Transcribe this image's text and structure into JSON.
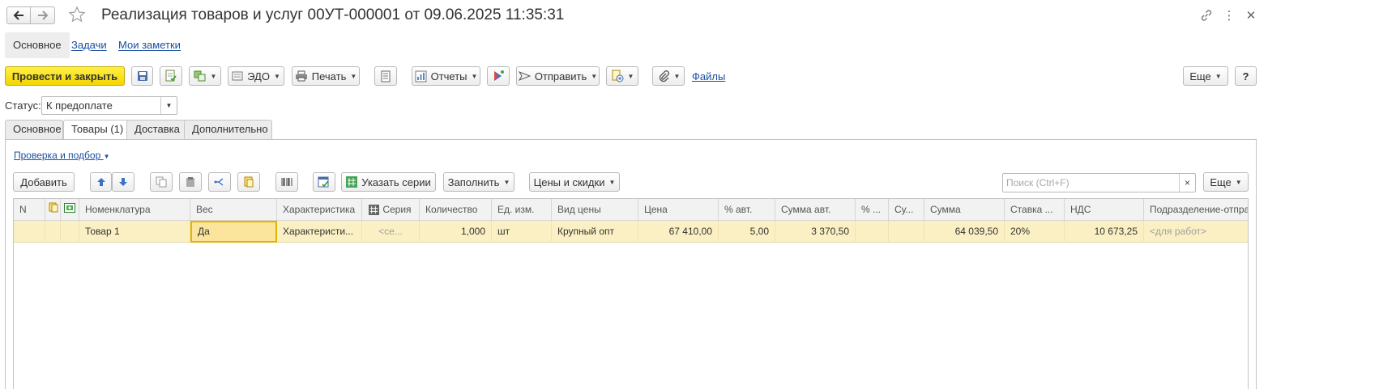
{
  "window": {
    "title": "Реализация товаров и услуг 00УТ-000001 от 09.06.2025 11:35:31",
    "back_icon": "arrow-left-icon",
    "forward_icon": "arrow-right-icon",
    "favorite_icon": "star-icon",
    "link_icon": "link-icon",
    "menu_icon": "more-vertical-icon",
    "close_icon": "close-icon"
  },
  "top_tabs": [
    {
      "label": "Основное",
      "active": true
    },
    {
      "label": "Задачи",
      "active": false
    },
    {
      "label": "Мои заметки",
      "active": false
    }
  ],
  "toolbar": {
    "post_close": "Провести и закрыть",
    "edo": "ЭДО",
    "print": "Печать",
    "reports": "Отчеты",
    "send": "Отправить",
    "files": "Файлы",
    "more": "Еще",
    "help": "?"
  },
  "status": {
    "label": "Статус:",
    "value": "К предоплате"
  },
  "doc_tabs": [
    {
      "label": "Основное",
      "active": false
    },
    {
      "label": "Товары (1)",
      "active": true
    },
    {
      "label": "Доставка",
      "active": false
    },
    {
      "label": "Дополнительно",
      "active": false
    }
  ],
  "goods": {
    "check_link": "Проверка и подбор",
    "add": "Добавить",
    "specify_series": "Указать серии",
    "fill": "Заполнить",
    "prices": "Цены и скидки",
    "search_placeholder": "Поиск (Ctrl+F)",
    "search_clear": "×",
    "more": "Еще"
  },
  "table": {
    "columns": [
      "N",
      "",
      "",
      "Номенклатура",
      "Вес",
      "Характеристика",
      "Серия",
      "Количество",
      "Ед. изм.",
      "Вид цены",
      "Цена",
      "% авт.",
      "Сумма авт.",
      "% ...",
      "Су...",
      "Сумма",
      "Ставка ...",
      "НДС",
      "Подразделение-отпра"
    ],
    "rows": [
      [
        "",
        "",
        "",
        "Товар 1",
        "Да",
        "Характеристи...",
        "<се...",
        "1,000",
        "шт",
        "Крупный опт",
        "67 410,00",
        "5,00",
        "3 370,50",
        "",
        "",
        "64 039,50",
        "20%",
        "10 673,25",
        "<для работ>"
      ]
    ]
  },
  "colors": {
    "accent_yellow": "#f3d500",
    "link_blue": "#1a4fa0",
    "row_highlight": "#fbf0c3",
    "selected_cell_border": "#e0b400"
  }
}
